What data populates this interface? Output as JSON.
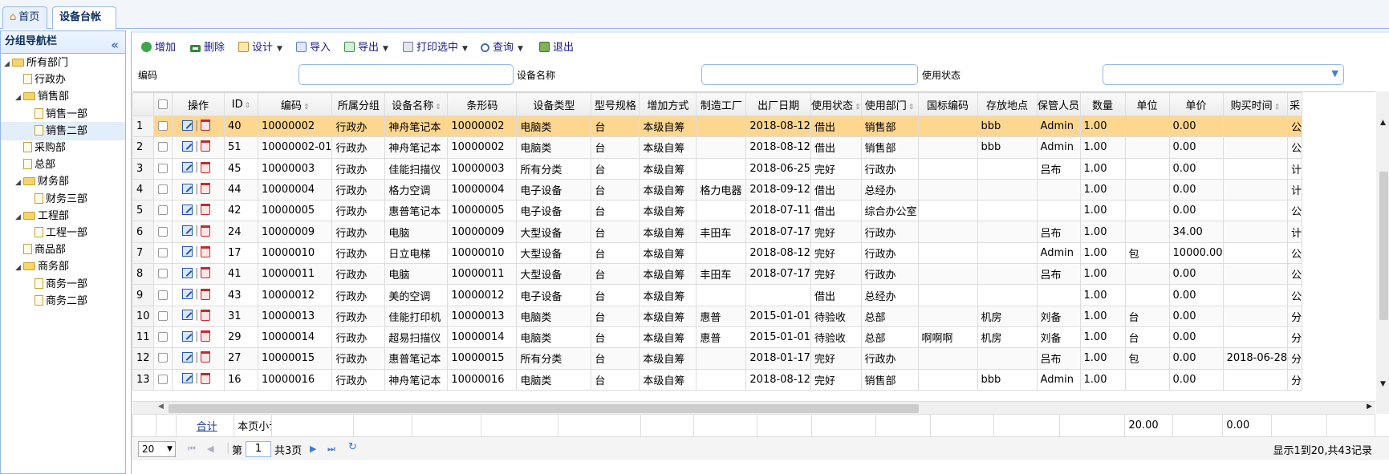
{
  "tabs": [
    {
      "label": "首页",
      "icon": "home-icon"
    },
    {
      "label": "设备台帐",
      "close": "×",
      "active": true
    }
  ],
  "sidebar": {
    "title": "分组导航栏",
    "collapse_glyph": "«",
    "tree": [
      {
        "label": "所有部门",
        "type": "folder",
        "expanded": true,
        "level": 0
      },
      {
        "label": "行政办",
        "type": "file",
        "level": 1
      },
      {
        "label": "销售部",
        "type": "folder",
        "expanded": true,
        "level": 1
      },
      {
        "label": "销售一部",
        "type": "file",
        "level": 2
      },
      {
        "label": "销售二部",
        "type": "file",
        "level": 2,
        "selected": true
      },
      {
        "label": "采购部",
        "type": "file",
        "level": 1
      },
      {
        "label": "总部",
        "type": "file",
        "level": 1
      },
      {
        "label": "财务部",
        "type": "folder",
        "expanded": true,
        "level": 1
      },
      {
        "label": "财务三部",
        "type": "file",
        "level": 2
      },
      {
        "label": "工程部",
        "type": "folder",
        "expanded": true,
        "level": 1
      },
      {
        "label": "工程一部",
        "type": "file",
        "level": 2
      },
      {
        "label": "商品部",
        "type": "file",
        "level": 1
      },
      {
        "label": "商务部",
        "type": "folder",
        "expanded": true,
        "level": 1
      },
      {
        "label": "商务一部",
        "type": "file",
        "level": 2
      },
      {
        "label": "商务二部",
        "type": "file",
        "level": 2
      }
    ]
  },
  "toolbar": {
    "add": "增加",
    "delete": "删除",
    "design": "设计",
    "import": "导入",
    "export": "导出",
    "print": "打印选中",
    "query": "查询",
    "exit": "退出"
  },
  "filters": {
    "code_label": "编码",
    "name_label": "设备名称",
    "status_label": "使用状态",
    "code_value": "",
    "name_value": "",
    "status_value": ""
  },
  "columns": [
    "操作",
    "ID",
    "编码",
    "所属分组",
    "设备名称",
    "条形码",
    "设备类型",
    "型号规格",
    "增加方式",
    "制造工厂",
    "出厂日期",
    "使用状态",
    "使用部门",
    "国标编码",
    "存放地点",
    "保管人员",
    "数量",
    "单位",
    "单价",
    "购买时间",
    "采"
  ],
  "rows": [
    {
      "n": "1",
      "id": "40",
      "code": "10000002",
      "group": "行政办",
      "name": "神舟笔记本",
      "barcode": "10000002",
      "type": "电脑类",
      "model": "台",
      "add": "本级自筹",
      "factory": "",
      "date": "2018-08-12",
      "status": "借出",
      "dept": "销售部",
      "gb": "",
      "loc": "bbb",
      "keeper": "Admin",
      "qty": "1.00",
      "unit": "",
      "price": "0.00",
      "buy": "",
      "extra": "公",
      "selected": true
    },
    {
      "n": "2",
      "id": "51",
      "code": "10000002-01",
      "group": "行政办",
      "name": "神舟笔记本",
      "barcode": "10000002",
      "type": "电脑类",
      "model": "台",
      "add": "本级自筹",
      "factory": "",
      "date": "2018-08-12",
      "status": "借出",
      "dept": "销售部",
      "gb": "",
      "loc": "bbb",
      "keeper": "Admin",
      "qty": "1.00",
      "unit": "",
      "price": "0.00",
      "buy": "",
      "extra": "公"
    },
    {
      "n": "3",
      "id": "45",
      "code": "10000003",
      "group": "行政办",
      "name": "佳能扫描仪",
      "barcode": "10000003",
      "type": "所有分类",
      "model": "台",
      "add": "本级自筹",
      "factory": "",
      "date": "2018-06-25",
      "status": "完好",
      "dept": "行政办",
      "gb": "",
      "loc": "",
      "keeper": "吕布",
      "qty": "1.00",
      "unit": "",
      "price": "0.00",
      "buy": "",
      "extra": "计"
    },
    {
      "n": "4",
      "id": "44",
      "code": "10000004",
      "group": "行政办",
      "name": "格力空调",
      "barcode": "10000004",
      "type": "电子设备",
      "model": "台",
      "add": "本级自筹",
      "factory": "格力电器",
      "date": "2018-09-12",
      "status": "借出",
      "dept": "总经办",
      "gb": "",
      "loc": "",
      "keeper": "",
      "qty": "1.00",
      "unit": "",
      "price": "0.00",
      "buy": "",
      "extra": "计"
    },
    {
      "n": "5",
      "id": "42",
      "code": "10000005",
      "group": "行政办",
      "name": "惠普笔记本",
      "barcode": "10000005",
      "type": "电子设备",
      "model": "台",
      "add": "本级自筹",
      "factory": "",
      "date": "2018-07-11",
      "status": "借出",
      "dept": "综合办公室",
      "gb": "",
      "loc": "",
      "keeper": "",
      "qty": "1.00",
      "unit": "",
      "price": "0.00",
      "buy": "",
      "extra": "公"
    },
    {
      "n": "6",
      "id": "24",
      "code": "10000009",
      "group": "行政办",
      "name": "电脑",
      "barcode": "10000009",
      "type": "大型设备",
      "model": "台",
      "add": "本级自筹",
      "factory": "丰田车",
      "date": "2018-07-17",
      "status": "完好",
      "dept": "行政办",
      "gb": "",
      "loc": "",
      "keeper": "吕布",
      "qty": "1.00",
      "unit": "",
      "price": "34.00",
      "buy": "",
      "extra": "计"
    },
    {
      "n": "7",
      "id": "17",
      "code": "10000010",
      "group": "行政办",
      "name": "日立电梯",
      "barcode": "10000010",
      "type": "大型设备",
      "model": "台",
      "add": "本级自筹",
      "factory": "",
      "date": "2018-08-12",
      "status": "完好",
      "dept": "行政办",
      "gb": "",
      "loc": "",
      "keeper": "Admin",
      "qty": "1.00",
      "unit": "包",
      "price": "10000.00",
      "buy": "",
      "extra": "公"
    },
    {
      "n": "8",
      "id": "41",
      "code": "10000011",
      "group": "行政办",
      "name": "电脑",
      "barcode": "10000011",
      "type": "大型设备",
      "model": "台",
      "add": "本级自筹",
      "factory": "丰田车",
      "date": "2018-07-17",
      "status": "完好",
      "dept": "行政办",
      "gb": "",
      "loc": "",
      "keeper": "吕布",
      "qty": "1.00",
      "unit": "",
      "price": "0.00",
      "buy": "",
      "extra": "公"
    },
    {
      "n": "9",
      "id": "43",
      "code": "10000012",
      "group": "行政办",
      "name": "美的空调",
      "barcode": "10000012",
      "type": "电子设备",
      "model": "台",
      "add": "本级自筹",
      "factory": "",
      "date": "",
      "status": "借出",
      "dept": "总经办",
      "gb": "",
      "loc": "",
      "keeper": "",
      "qty": "1.00",
      "unit": "",
      "price": "0.00",
      "buy": "",
      "extra": "公"
    },
    {
      "n": "10",
      "id": "31",
      "code": "10000013",
      "group": "行政办",
      "name": "佳能打印机",
      "barcode": "10000013",
      "type": "电脑类",
      "model": "台",
      "add": "本级自筹",
      "factory": "惠普",
      "date": "2015-01-01",
      "status": "待验收",
      "dept": "总部",
      "gb": "",
      "loc": "机房",
      "keeper": "刘备",
      "qty": "1.00",
      "unit": "台",
      "price": "0.00",
      "buy": "",
      "extra": "分"
    },
    {
      "n": "11",
      "id": "29",
      "code": "10000014",
      "group": "行政办",
      "name": "超易扫描仪",
      "barcode": "10000014",
      "type": "电脑类",
      "model": "台",
      "add": "本级自筹",
      "factory": "惠普",
      "date": "2015-01-01",
      "status": "待验收",
      "dept": "总部",
      "gb": "啊啊啊",
      "loc": "机房",
      "keeper": "刘备",
      "qty": "1.00",
      "unit": "台",
      "price": "0.00",
      "buy": "",
      "extra": "分"
    },
    {
      "n": "12",
      "id": "27",
      "code": "10000015",
      "group": "行政办",
      "name": "惠普笔记本",
      "barcode": "10000015",
      "type": "所有分类",
      "model": "台",
      "add": "本级自筹",
      "factory": "",
      "date": "2018-01-17",
      "status": "完好",
      "dept": "行政办",
      "gb": "",
      "loc": "",
      "keeper": "吕布",
      "qty": "1.00",
      "unit": "包",
      "price": "0.00",
      "buy": "2018-06-28",
      "extra": "分"
    },
    {
      "n": "13",
      "id": "16",
      "code": "10000016",
      "group": "行政办",
      "name": "神舟笔记本",
      "barcode": "10000016",
      "type": "电脑类",
      "model": "台",
      "add": "本级自筹",
      "factory": "",
      "date": "2018-08-12",
      "status": "完好",
      "dept": "销售部",
      "gb": "",
      "loc": "bbb",
      "keeper": "Admin",
      "qty": "1.00",
      "unit": "",
      "price": "0.00",
      "buy": "",
      "extra": "分"
    }
  ],
  "footer": {
    "total_link": "合计",
    "subtotal_label": "本页小计",
    "qty_total": "20.00",
    "price_total": "0.00"
  },
  "pager": {
    "page_size": "20",
    "page_prefix": "第",
    "page_num": "1",
    "page_suffix": "共3页",
    "info": "显示1到20,共43记录"
  }
}
